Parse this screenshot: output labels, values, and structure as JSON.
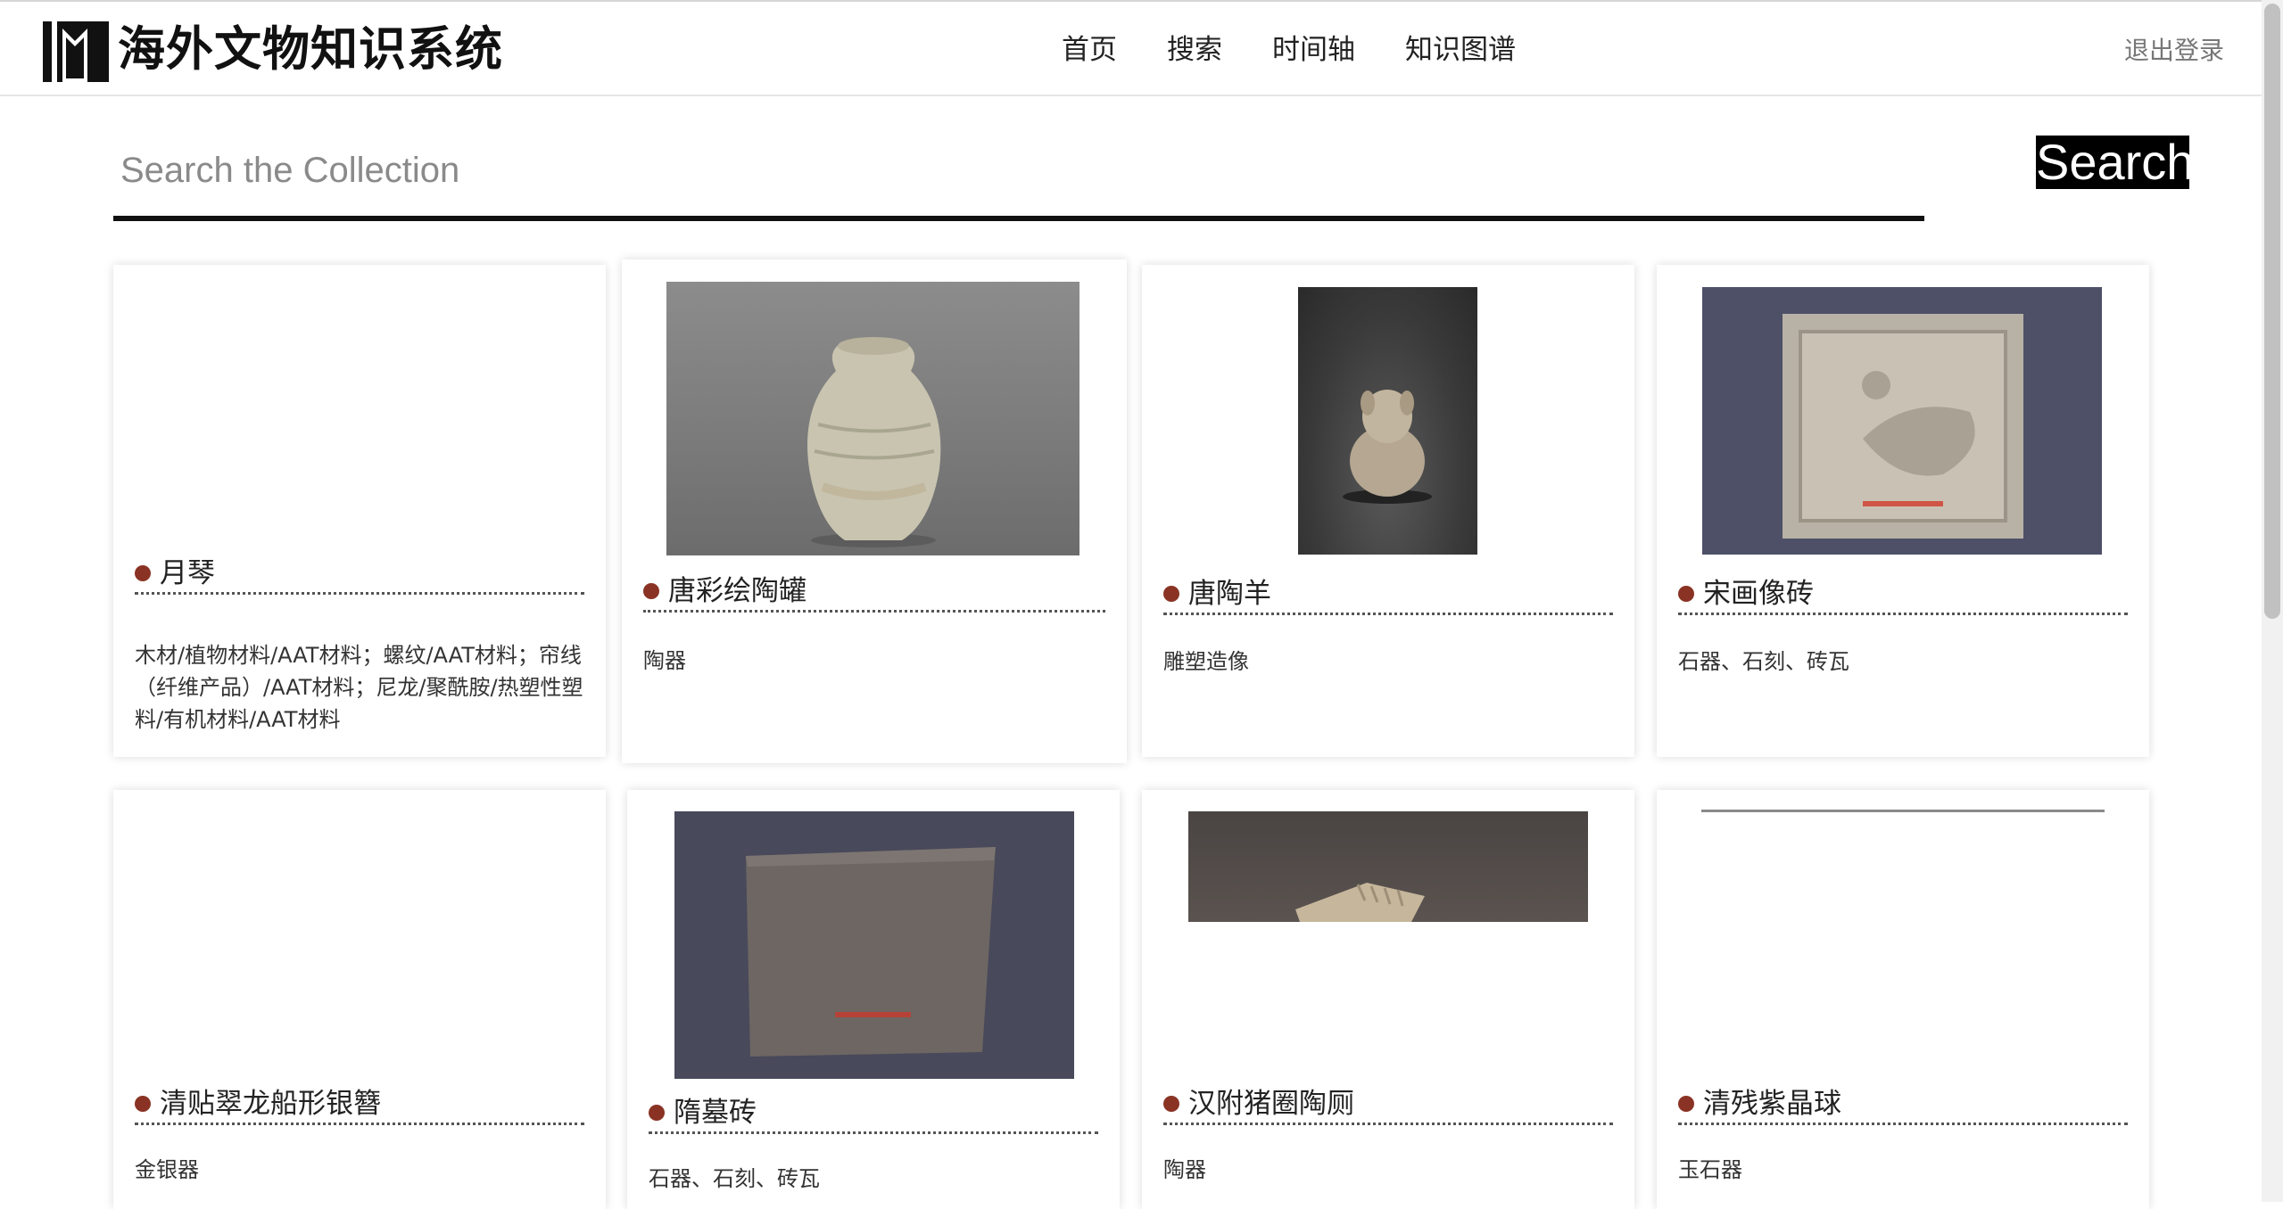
{
  "header": {
    "site_title": "海外文物知识系统",
    "logo_icon": "museum-logo-icon",
    "nav": [
      {
        "label": "首页"
      },
      {
        "label": "搜索"
      },
      {
        "label": "时间轴"
      },
      {
        "label": "知识图谱"
      }
    ],
    "logout_label": "退出登录"
  },
  "search": {
    "placeholder": "Search the Collection",
    "value": "",
    "button_label": "Search"
  },
  "colors": {
    "bullet": "#8a3324",
    "search_button_bg": "#000000",
    "underline": "#111111"
  },
  "cards": [
    {
      "title": "月琴",
      "desc": "木材/植物材料/AAT材料；螺纹/AAT材料；帘线（纤维产品）/AAT材料；尼龙/聚酰胺/热塑性塑料/有机材料/AAT材料",
      "image": "none"
    },
    {
      "title": "唐彩绘陶罐",
      "desc": "陶器",
      "image": "pottery-jar-photo"
    },
    {
      "title": "唐陶羊",
      "desc": "雕塑造像",
      "image": "pottery-sheep-photo"
    },
    {
      "title": "宋画像砖",
      "desc": "石器、石刻、砖瓦",
      "image": "pictorial-brick-photo"
    },
    {
      "title": "清贴翠龙船形银簪",
      "desc": "金银器",
      "image": "none"
    },
    {
      "title": "隋墓砖",
      "desc": "石器、石刻、砖瓦",
      "image": "tomb-brick-photo"
    },
    {
      "title": "汉附猪圈陶厕",
      "desc": "陶器",
      "image": "pottery-pigsty-photo"
    },
    {
      "title": "清残紫晶球",
      "desc": "玉石器",
      "image": "broken-image"
    }
  ]
}
